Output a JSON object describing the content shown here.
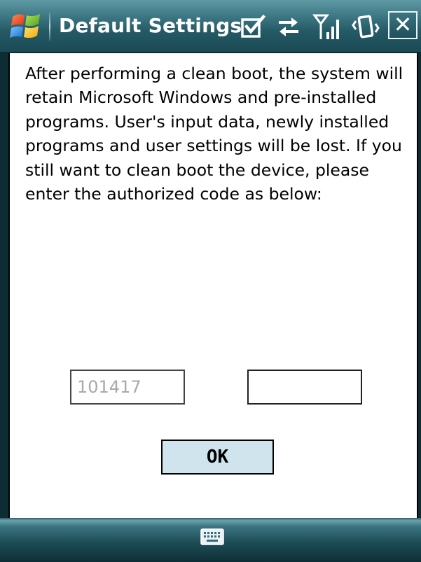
{
  "titlebar": {
    "title": "Default Settings",
    "icons": [
      "start-menu-icon",
      "checkbox-icon",
      "connectivity-icon",
      "signal-strength-icon",
      "vibrate-icon"
    ],
    "close_label": "✕"
  },
  "main": {
    "message": "After performing a clean boot, the system will retain Microsoft Windows and pre-installed programs. User's input data, newly installed programs and user settings will be lost. If you still want to clean boot the device, please enter the authorized code as below:",
    "code_display_value": "101417",
    "code_entry_value": "",
    "ok_label": "OK"
  },
  "bottombar": {
    "icon": "keyboard-icon"
  },
  "colors": {
    "titlebar": "#2f6a76",
    "ok_button_bg": "#cfe4ec",
    "content_bg": "#ffffff",
    "disabled_text": "#a9a9a9"
  }
}
